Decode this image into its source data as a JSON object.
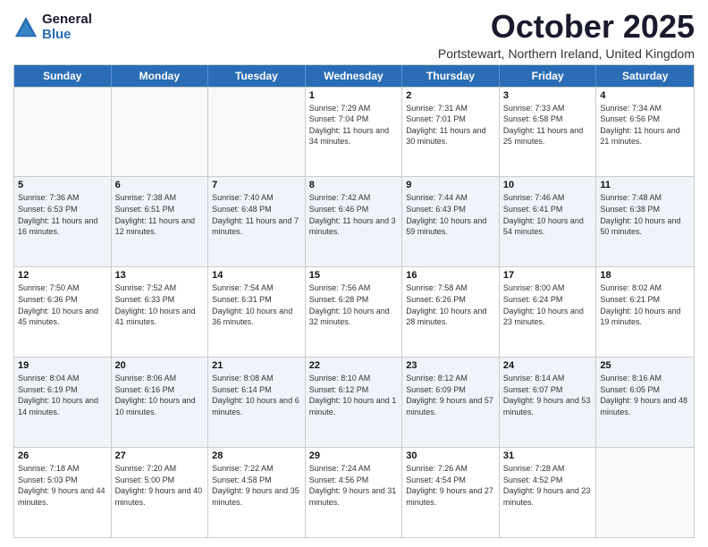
{
  "logo": {
    "general": "General",
    "blue": "Blue"
  },
  "title": "October 2025",
  "location": "Portstewart, Northern Ireland, United Kingdom",
  "days": [
    "Sunday",
    "Monday",
    "Tuesday",
    "Wednesday",
    "Thursday",
    "Friday",
    "Saturday"
  ],
  "rows": [
    [
      {
        "day": "",
        "sunrise": "",
        "sunset": "",
        "daylight": ""
      },
      {
        "day": "",
        "sunrise": "",
        "sunset": "",
        "daylight": ""
      },
      {
        "day": "",
        "sunrise": "",
        "sunset": "",
        "daylight": ""
      },
      {
        "day": "1",
        "sunrise": "Sunrise: 7:29 AM",
        "sunset": "Sunset: 7:04 PM",
        "daylight": "Daylight: 11 hours and 34 minutes."
      },
      {
        "day": "2",
        "sunrise": "Sunrise: 7:31 AM",
        "sunset": "Sunset: 7:01 PM",
        "daylight": "Daylight: 11 hours and 30 minutes."
      },
      {
        "day": "3",
        "sunrise": "Sunrise: 7:33 AM",
        "sunset": "Sunset: 6:58 PM",
        "daylight": "Daylight: 11 hours and 25 minutes."
      },
      {
        "day": "4",
        "sunrise": "Sunrise: 7:34 AM",
        "sunset": "Sunset: 6:56 PM",
        "daylight": "Daylight: 11 hours and 21 minutes."
      }
    ],
    [
      {
        "day": "5",
        "sunrise": "Sunrise: 7:36 AM",
        "sunset": "Sunset: 6:53 PM",
        "daylight": "Daylight: 11 hours and 16 minutes."
      },
      {
        "day": "6",
        "sunrise": "Sunrise: 7:38 AM",
        "sunset": "Sunset: 6:51 PM",
        "daylight": "Daylight: 11 hours and 12 minutes."
      },
      {
        "day": "7",
        "sunrise": "Sunrise: 7:40 AM",
        "sunset": "Sunset: 6:48 PM",
        "daylight": "Daylight: 11 hours and 7 minutes."
      },
      {
        "day": "8",
        "sunrise": "Sunrise: 7:42 AM",
        "sunset": "Sunset: 6:46 PM",
        "daylight": "Daylight: 11 hours and 3 minutes."
      },
      {
        "day": "9",
        "sunrise": "Sunrise: 7:44 AM",
        "sunset": "Sunset: 6:43 PM",
        "daylight": "Daylight: 10 hours and 59 minutes."
      },
      {
        "day": "10",
        "sunrise": "Sunrise: 7:46 AM",
        "sunset": "Sunset: 6:41 PM",
        "daylight": "Daylight: 10 hours and 54 minutes."
      },
      {
        "day": "11",
        "sunrise": "Sunrise: 7:48 AM",
        "sunset": "Sunset: 6:38 PM",
        "daylight": "Daylight: 10 hours and 50 minutes."
      }
    ],
    [
      {
        "day": "12",
        "sunrise": "Sunrise: 7:50 AM",
        "sunset": "Sunset: 6:36 PM",
        "daylight": "Daylight: 10 hours and 45 minutes."
      },
      {
        "day": "13",
        "sunrise": "Sunrise: 7:52 AM",
        "sunset": "Sunset: 6:33 PM",
        "daylight": "Daylight: 10 hours and 41 minutes."
      },
      {
        "day": "14",
        "sunrise": "Sunrise: 7:54 AM",
        "sunset": "Sunset: 6:31 PM",
        "daylight": "Daylight: 10 hours and 36 minutes."
      },
      {
        "day": "15",
        "sunrise": "Sunrise: 7:56 AM",
        "sunset": "Sunset: 6:28 PM",
        "daylight": "Daylight: 10 hours and 32 minutes."
      },
      {
        "day": "16",
        "sunrise": "Sunrise: 7:58 AM",
        "sunset": "Sunset: 6:26 PM",
        "daylight": "Daylight: 10 hours and 28 minutes."
      },
      {
        "day": "17",
        "sunrise": "Sunrise: 8:00 AM",
        "sunset": "Sunset: 6:24 PM",
        "daylight": "Daylight: 10 hours and 23 minutes."
      },
      {
        "day": "18",
        "sunrise": "Sunrise: 8:02 AM",
        "sunset": "Sunset: 6:21 PM",
        "daylight": "Daylight: 10 hours and 19 minutes."
      }
    ],
    [
      {
        "day": "19",
        "sunrise": "Sunrise: 8:04 AM",
        "sunset": "Sunset: 6:19 PM",
        "daylight": "Daylight: 10 hours and 14 minutes."
      },
      {
        "day": "20",
        "sunrise": "Sunrise: 8:06 AM",
        "sunset": "Sunset: 6:16 PM",
        "daylight": "Daylight: 10 hours and 10 minutes."
      },
      {
        "day": "21",
        "sunrise": "Sunrise: 8:08 AM",
        "sunset": "Sunset: 6:14 PM",
        "daylight": "Daylight: 10 hours and 6 minutes."
      },
      {
        "day": "22",
        "sunrise": "Sunrise: 8:10 AM",
        "sunset": "Sunset: 6:12 PM",
        "daylight": "Daylight: 10 hours and 1 minute."
      },
      {
        "day": "23",
        "sunrise": "Sunrise: 8:12 AM",
        "sunset": "Sunset: 6:09 PM",
        "daylight": "Daylight: 9 hours and 57 minutes."
      },
      {
        "day": "24",
        "sunrise": "Sunrise: 8:14 AM",
        "sunset": "Sunset: 6:07 PM",
        "daylight": "Daylight: 9 hours and 53 minutes."
      },
      {
        "day": "25",
        "sunrise": "Sunrise: 8:16 AM",
        "sunset": "Sunset: 6:05 PM",
        "daylight": "Daylight: 9 hours and 48 minutes."
      }
    ],
    [
      {
        "day": "26",
        "sunrise": "Sunrise: 7:18 AM",
        "sunset": "Sunset: 5:03 PM",
        "daylight": "Daylight: 9 hours and 44 minutes."
      },
      {
        "day": "27",
        "sunrise": "Sunrise: 7:20 AM",
        "sunset": "Sunset: 5:00 PM",
        "daylight": "Daylight: 9 hours and 40 minutes."
      },
      {
        "day": "28",
        "sunrise": "Sunrise: 7:22 AM",
        "sunset": "Sunset: 4:58 PM",
        "daylight": "Daylight: 9 hours and 35 minutes."
      },
      {
        "day": "29",
        "sunrise": "Sunrise: 7:24 AM",
        "sunset": "Sunset: 4:56 PM",
        "daylight": "Daylight: 9 hours and 31 minutes."
      },
      {
        "day": "30",
        "sunrise": "Sunrise: 7:26 AM",
        "sunset": "Sunset: 4:54 PM",
        "daylight": "Daylight: 9 hours and 27 minutes."
      },
      {
        "day": "31",
        "sunrise": "Sunrise: 7:28 AM",
        "sunset": "Sunset: 4:52 PM",
        "daylight": "Daylight: 9 hours and 23 minutes."
      },
      {
        "day": "",
        "sunrise": "",
        "sunset": "",
        "daylight": ""
      }
    ]
  ]
}
